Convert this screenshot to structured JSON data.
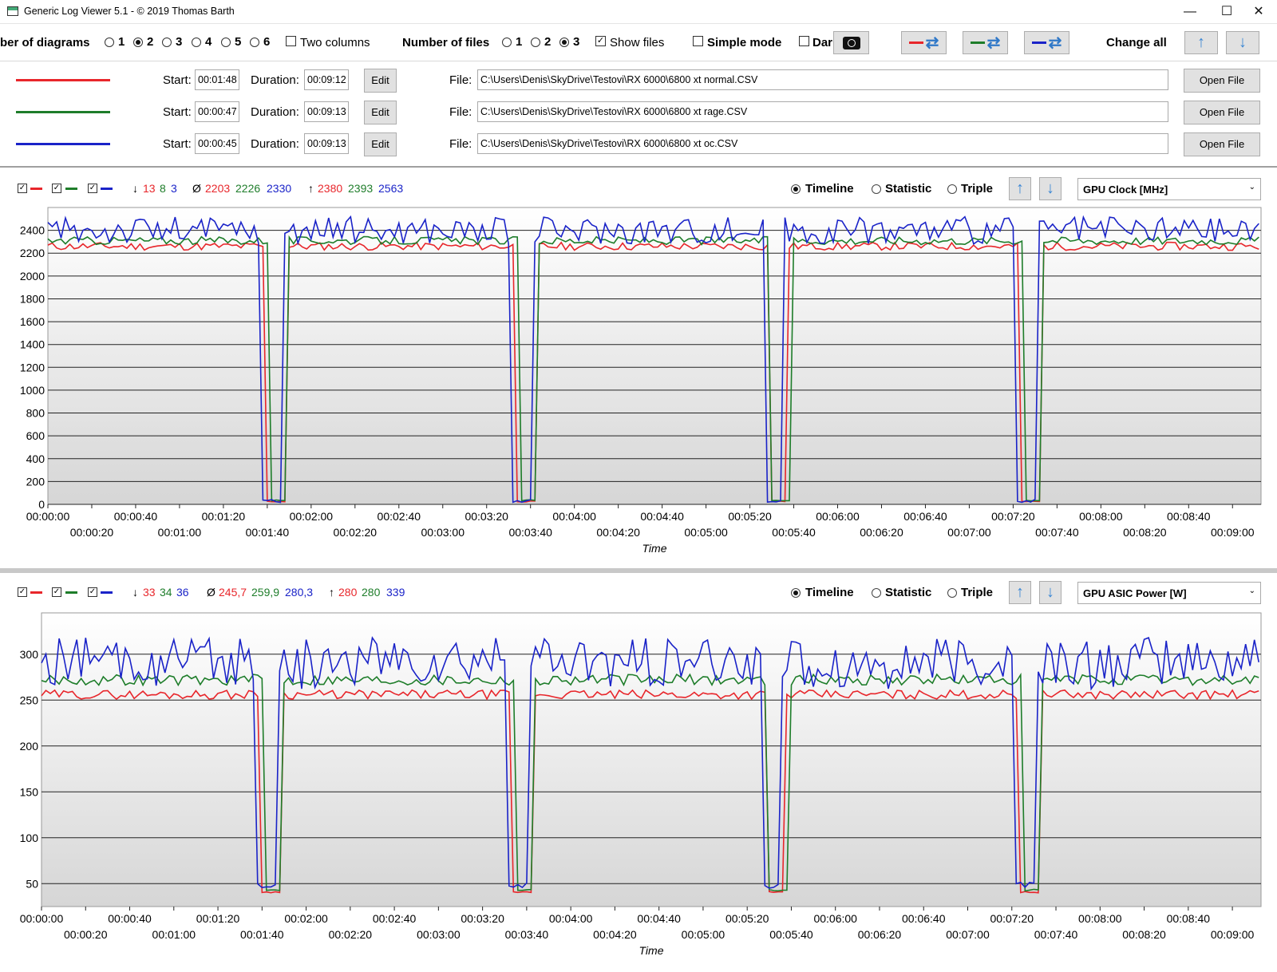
{
  "window": {
    "title": "Generic Log Viewer 5.1 - © 2019 Thomas Barth",
    "minimize": "—",
    "maximize": "☐",
    "close": "✕"
  },
  "toolbar": {
    "num_diagrams_label": "ber of diagrams",
    "diagram_options": [
      "1",
      "2",
      "3",
      "4",
      "5",
      "6"
    ],
    "diagram_selected": "2",
    "two_columns_label": "Two columns",
    "num_files_label": "Number of files",
    "file_options": [
      "1",
      "2",
      "3"
    ],
    "files_selected": "3",
    "show_files_label": "Show files",
    "simple_mode_label": "Simple mode",
    "dark_label": "Dar",
    "change_all_label": "Change all",
    "up_icon": "↑",
    "down_icon": "↓",
    "swap_icon": "⇄"
  },
  "files": [
    {
      "color": "#e8262b",
      "start_label": "Start:",
      "start": "00:01:48",
      "duration_label": "Duration:",
      "duration": "00:09:12",
      "edit": "Edit",
      "file_label": "File:",
      "path": "C:\\Users\\Denis\\SkyDrive\\Testovi\\RX 6000\\6800 xt normal.CSV",
      "open": "Open File"
    },
    {
      "color": "#1e7d2a",
      "start_label": "Start:",
      "start": "00:00:47",
      "duration_label": "Duration:",
      "duration": "00:09:13",
      "edit": "Edit",
      "file_label": "File:",
      "path": "C:\\Users\\Denis\\SkyDrive\\Testovi\\RX 6000\\6800 xt rage.CSV",
      "open": "Open File"
    },
    {
      "color": "#1a23c8",
      "start_label": "Start:",
      "start": "00:00:45",
      "duration_label": "Duration:",
      "duration": "00:09:13",
      "edit": "Edit",
      "file_label": "File:",
      "path": "C:\\Users\\Denis\\SkyDrive\\Testovi\\RX 6000\\6800 xt oc.CSV",
      "open": "Open File"
    }
  ],
  "colors": {
    "red": "#e8262b",
    "green": "#1e7d2a",
    "blue": "#1a23c8"
  },
  "modes": {
    "timeline": "Timeline",
    "statistic": "Statistic",
    "triple": "Triple"
  },
  "diagrams": [
    {
      "min_symbol": "↓",
      "avg_symbol": "Ø",
      "max_symbol": "↑",
      "min": [
        "13",
        "8",
        "3"
      ],
      "avg": [
        "2203",
        "2226",
        "2330"
      ],
      "max": [
        "2380",
        "2393",
        "2563"
      ],
      "sensor": "GPU Clock [MHz]"
    },
    {
      "min_symbol": "↓",
      "avg_symbol": "Ø",
      "max_symbol": "↑",
      "min": [
        "33",
        "34",
        "36"
      ],
      "avg": [
        "245,7",
        "259,9",
        "280,3"
      ],
      "max": [
        "280",
        "280",
        "339"
      ],
      "sensor": "GPU ASIC Power [W]"
    }
  ],
  "chart_data": [
    {
      "type": "line",
      "xlabel": "Time",
      "ylabel": "",
      "ylim": [
        0,
        2600
      ],
      "yticks": [
        "2400",
        "2200",
        "2000",
        "1800",
        "1600",
        "1400",
        "1200",
        "1000",
        "800",
        "600",
        "400",
        "200",
        "0"
      ],
      "xticks_upper": [
        "00:00:00",
        "00:00:40",
        "00:01:20",
        "00:02:00",
        "00:02:40",
        "00:03:20",
        "00:04:00",
        "00:04:40",
        "00:05:20",
        "00:06:00",
        "00:06:40",
        "00:07:20",
        "00:08:00",
        "00:08:40"
      ],
      "xticks_lower": [
        "00:00:20",
        "00:01:00",
        "00:01:40",
        "00:02:20",
        "00:03:00",
        "00:03:40",
        "00:04:20",
        "00:05:00",
        "00:05:40",
        "00:06:20",
        "00:07:00",
        "00:07:40",
        "00:08:20",
        "00:09:00"
      ],
      "xlim_seconds": [
        0,
        553
      ],
      "dips_seconds": [
        [
          100,
          108
        ],
        [
          214,
          222
        ],
        [
          329,
          337
        ],
        [
          444,
          452
        ]
      ],
      "series": [
        {
          "color": "#e8262b",
          "base": 2260,
          "noise": 35,
          "low": 20
        },
        {
          "color": "#1e7d2a",
          "base": 2310,
          "noise": 35,
          "low": 30
        },
        {
          "color": "#1a23c8",
          "base": 2400,
          "noise": 120,
          "low": 10
        }
      ]
    },
    {
      "type": "line",
      "xlabel": "Time",
      "ylabel": "",
      "ylim": [
        25,
        345
      ],
      "yticks": [
        "300",
        "250",
        "200",
        "150",
        "100",
        "50"
      ],
      "xticks_upper": [
        "00:00:00",
        "00:00:40",
        "00:01:20",
        "00:02:00",
        "00:02:40",
        "00:03:20",
        "00:04:00",
        "00:04:40",
        "00:05:20",
        "00:06:00",
        "00:06:40",
        "00:07:20",
        "00:08:00",
        "00:08:40"
      ],
      "xticks_lower": [
        "00:00:20",
        "00:01:00",
        "00:01:40",
        "00:02:20",
        "00:03:00",
        "00:03:40",
        "00:04:20",
        "00:05:00",
        "00:05:40",
        "00:06:20",
        "00:07:00",
        "00:07:40",
        "00:08:20",
        "00:09:00"
      ],
      "xlim_seconds": [
        0,
        553
      ],
      "dips_seconds": [
        [
          100,
          108
        ],
        [
          214,
          222
        ],
        [
          329,
          337
        ],
        [
          444,
          452
        ]
      ],
      "series": [
        {
          "color": "#e8262b",
          "base": 256,
          "noise": 5,
          "low": 40
        },
        {
          "color": "#1e7d2a",
          "base": 272,
          "noise": 6,
          "low": 42
        },
        {
          "color": "#1a23c8",
          "base": 290,
          "noise": 28,
          "low": 45
        }
      ]
    }
  ]
}
